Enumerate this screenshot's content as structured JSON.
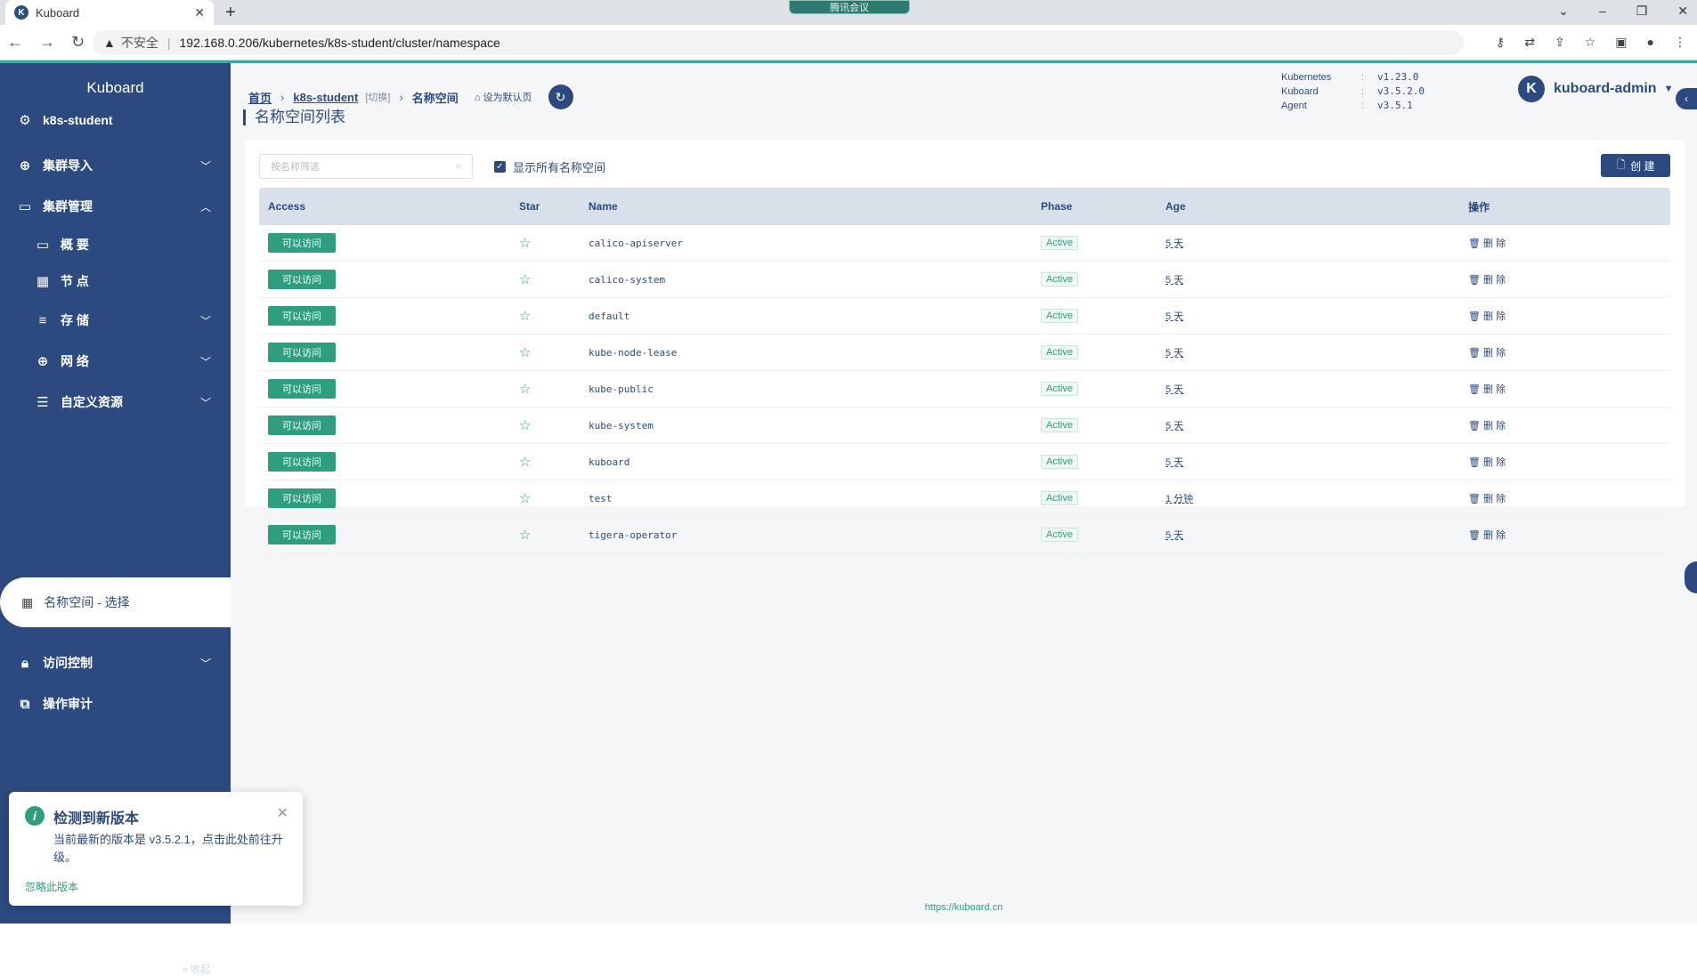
{
  "browser": {
    "tab_title": "Kuboard",
    "meeting_label": "腾讯会议",
    "insecure_label": "不安全",
    "url": "192.168.0.206/kubernetes/k8s-student/cluster/namespace"
  },
  "sidebar": {
    "brand": "Kuboard",
    "cluster": "k8s-student",
    "items": [
      {
        "label": "集群导入"
      },
      {
        "label": "集群管理"
      },
      {
        "label": "概 要"
      },
      {
        "label": "节 点"
      },
      {
        "label": "存 储"
      },
      {
        "label": "网 络"
      },
      {
        "label": "自定义资源"
      },
      {
        "label": "名称空间 - 选择"
      },
      {
        "label": "访问控制"
      },
      {
        "label": "操作审计"
      }
    ],
    "collapse_label": "« 收起"
  },
  "breadcrumb": {
    "home": "首页",
    "cluster": "k8s-student",
    "switch": "[切换]",
    "current": "名称空间",
    "set_default": "设为默认页"
  },
  "versions": [
    {
      "key": "Kubernetes",
      "value": "v1.23.0"
    },
    {
      "key": "Kuboard",
      "value": "v3.5.2.0"
    },
    {
      "key": "Agent",
      "value": "v3.5.1"
    }
  ],
  "user": {
    "avatar": "K",
    "name": "kuboard-admin"
  },
  "page": {
    "title": "名称空间列表",
    "filter_placeholder": "按名称筛选",
    "show_all": "显示所有名称空间",
    "create": "创 建"
  },
  "table": {
    "headers": {
      "access": "Access",
      "star": "Star",
      "name": "Name",
      "phase": "Phase",
      "age": "Age",
      "ops": "操作"
    },
    "rows": [
      {
        "access": "可以访问",
        "name": "calico-apiserver",
        "phase": "Active",
        "age": "5 天",
        "op": "删 除"
      },
      {
        "access": "可以访问",
        "name": "calico-system",
        "phase": "Active",
        "age": "5 天",
        "op": "删 除"
      },
      {
        "access": "可以访问",
        "name": "default",
        "phase": "Active",
        "age": "5 天",
        "op": "删 除"
      },
      {
        "access": "可以访问",
        "name": "kube-node-lease",
        "phase": "Active",
        "age": "5 天",
        "op": "删 除"
      },
      {
        "access": "可以访问",
        "name": "kube-public",
        "phase": "Active",
        "age": "5 天",
        "op": "删 除"
      },
      {
        "access": "可以访问",
        "name": "kube-system",
        "phase": "Active",
        "age": "5 天",
        "op": "删 除"
      },
      {
        "access": "可以访问",
        "name": "kuboard",
        "phase": "Active",
        "age": "5 天",
        "op": "删 除"
      },
      {
        "access": "可以访问",
        "name": "test",
        "phase": "Active",
        "age": "1 分钟",
        "op": "删 除"
      },
      {
        "access": "可以访问",
        "name": "tigera-operator",
        "phase": "Active",
        "age": "5 天",
        "op": "删 除"
      }
    ]
  },
  "footer": "https://kuboard.cn",
  "notification": {
    "title": "检测到新版本",
    "body": "当前最新的版本是 v3.5.2.1，点击此处前往升级。",
    "ignore": "忽略此版本"
  }
}
